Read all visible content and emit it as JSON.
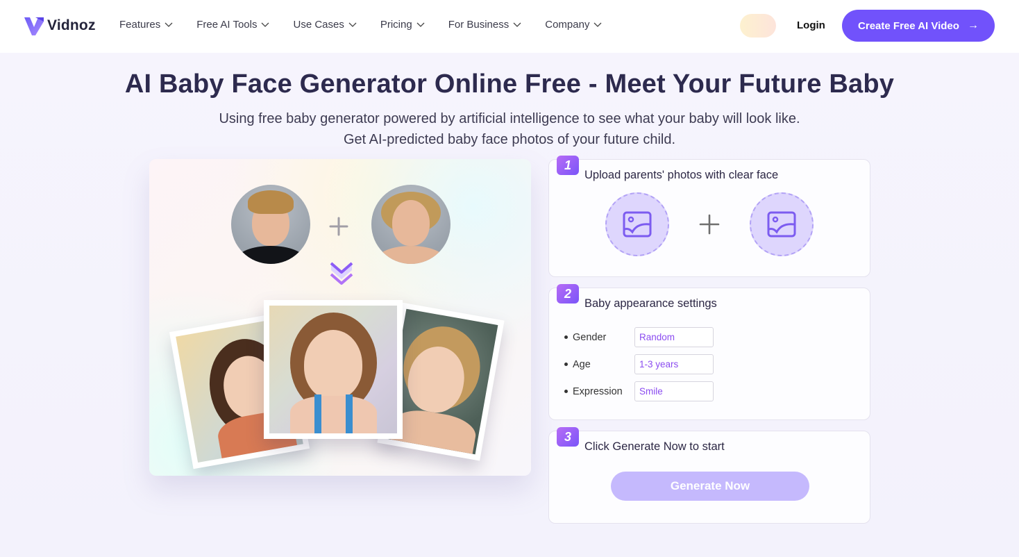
{
  "nav": {
    "brand": "Vidnoz",
    "menu": [
      {
        "label": "Features"
      },
      {
        "label": "Free AI Tools"
      },
      {
        "label": "Use Cases"
      },
      {
        "label": "Pricing"
      },
      {
        "label": "For Business"
      },
      {
        "label": "Company"
      }
    ],
    "login": "Login",
    "cta": "Create Free AI Video",
    "cta_arrow": "→"
  },
  "hero": {
    "title": "AI Baby Face Generator Online Free - Meet Your Future Baby",
    "subtitle_line1": "Using free baby generator powered by artificial intelligence to see what your baby will look like.",
    "subtitle_line2": "Get AI-predicted baby face photos of your future child."
  },
  "steps": [
    {
      "number": "1",
      "title": "Upload parents' photos with clear face"
    },
    {
      "number": "2",
      "title": "Baby appearance settings",
      "settings": [
        {
          "label": "Gender",
          "value": "Random"
        },
        {
          "label": "Age",
          "value": "1-3 years"
        },
        {
          "label": "Expression",
          "value": "Smile"
        }
      ]
    },
    {
      "number": "3",
      "title": "Click Generate Now to start",
      "button": "Generate Now"
    }
  ],
  "colors": {
    "brand": "#7152fb",
    "heading": "#2d2a4e",
    "setting_value": "#8b4cf0",
    "generate_disabled": "#c5b9fd",
    "upload_fill": "#ded6fd"
  }
}
